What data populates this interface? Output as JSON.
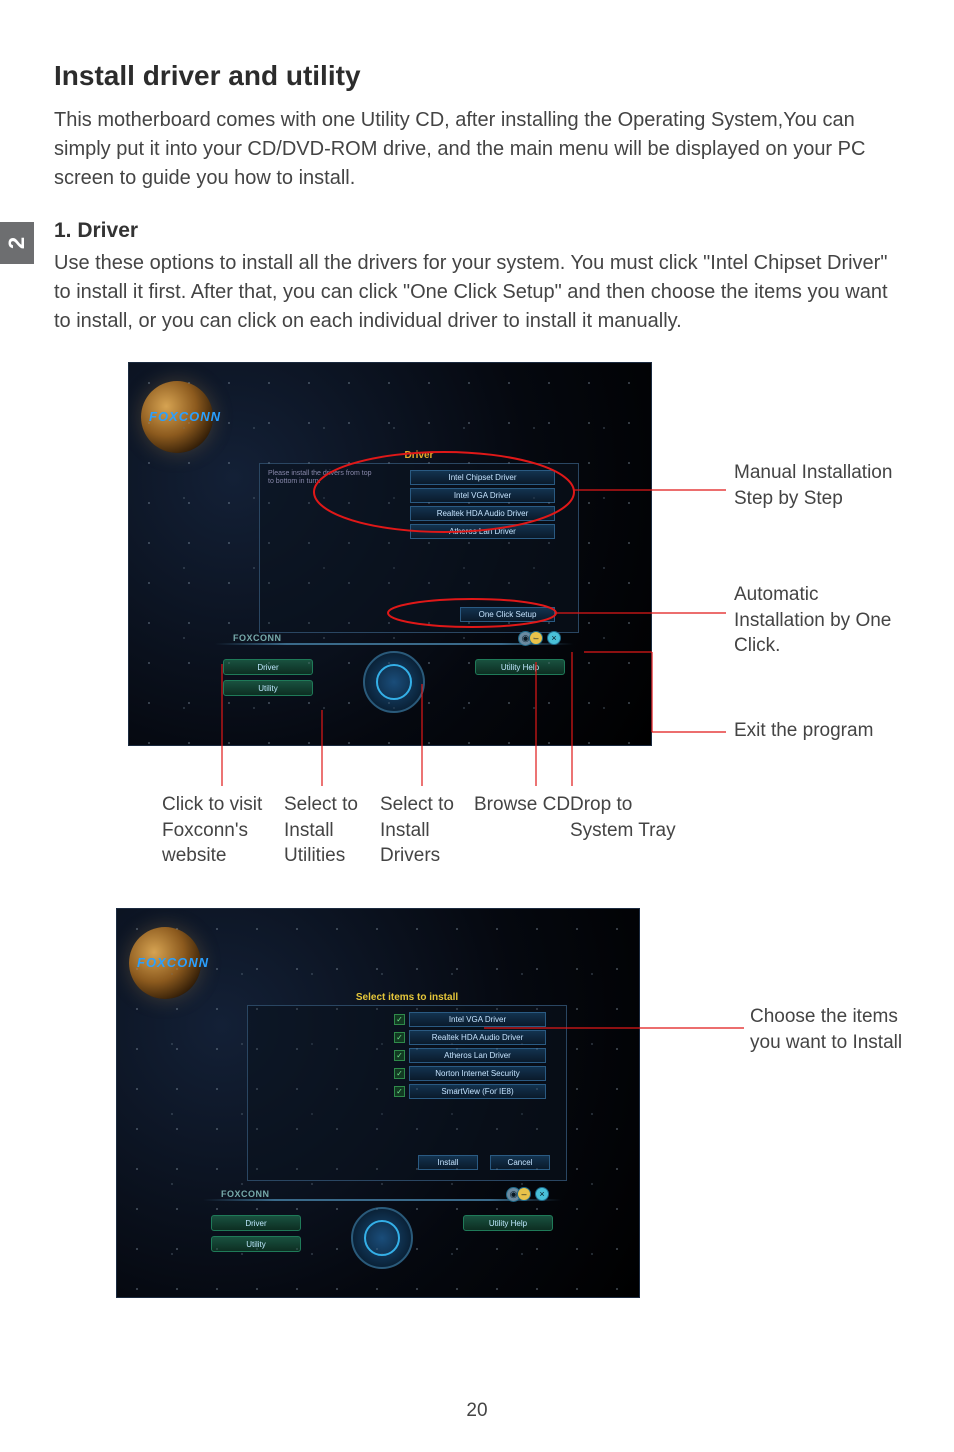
{
  "chapter_tab": "2",
  "page_number": "20",
  "heading_main": "Install driver and utility",
  "intro_para": "This motherboard comes with one Utility CD, after installing the Operating System,You can simply put it into your CD/DVD-ROM drive, and the main menu will be displayed on your PC screen to guide you how to install.",
  "section1_heading": "1. Driver",
  "section1_para": "Use these options to install all the drivers for your system. You must click \"Intel Chipset Driver\" to install it first. After that, you can click \"One Click Setup\" and then choose the items you want to install, or you can click on each individual driver to install it manually.",
  "shot1": {
    "brand_top": "FOXCONN",
    "panel_title": "Driver",
    "hint_text": "Please install the drivers from top to bottom in turn.",
    "drivers": [
      "Intel Chipset Driver",
      "Intel VGA Driver",
      "Realtek HDA Audio Driver",
      "Atheros Lan Driver"
    ],
    "one_click_label": "One Click Setup",
    "dock_brand": "FOXCONN",
    "dock_left": [
      "Driver",
      "Utility"
    ],
    "dock_right": [
      "Utility Help",
      ""
    ],
    "sys_min": "–",
    "sys_close": "×"
  },
  "callouts1": {
    "r1": "Manual Installation Step by Step",
    "r2": "Automatic Installation by One Click.",
    "r3": "Exit the program",
    "b1": "Click to visit Foxconn's website",
    "b2": "Select to Install Utilities",
    "b3": "Select to Install Drivers",
    "b4": "Browse CD",
    "b5": "Drop to System Tray"
  },
  "shot2": {
    "brand_top": "FOXCONN",
    "panel_title": "Select items to install",
    "items": [
      "Intel VGA Driver",
      "Realtek HDA Audio Driver",
      "Atheros Lan Driver",
      "Norton Internet Security",
      "SmartView (For IE8)"
    ],
    "btn_install": "Install",
    "btn_cancel": "Cancel",
    "dock_brand": "FOXCONN",
    "dock_left": [
      "Driver",
      "Utility"
    ],
    "dock_right": [
      "Utility Help",
      ""
    ]
  },
  "callouts2": {
    "r1": "Choose the items you want to Install"
  }
}
